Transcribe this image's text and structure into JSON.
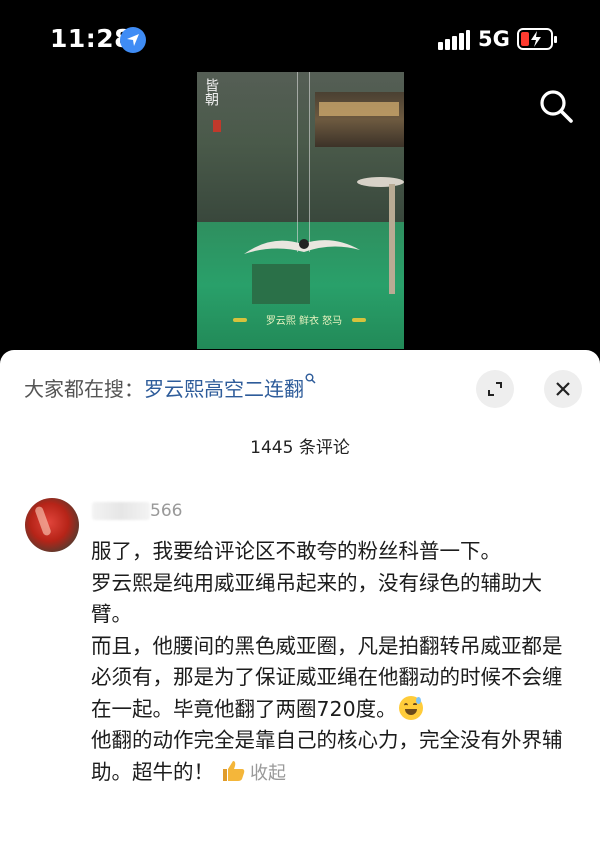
{
  "status_bar": {
    "time": "11:28",
    "network": "5G"
  },
  "video": {
    "logo_text": "皆朝",
    "caption": "罗云熙 鲜衣 怒马"
  },
  "search": {
    "prompt": "大家都在搜：",
    "term": "罗云熙高空二连翻",
    "term_icon": "search-small-icon"
  },
  "comments": {
    "count_label": "1445 条评论",
    "items": [
      {
        "username": "566",
        "paragraphs": [
          "服了，我要给评论区不敢夸的粉丝科普一下。",
          "罗云熙是纯用威亚绳吊起来的，没有绿色的辅助大臂。",
          "而且，他腰间的黑色威亚圈，凡是拍翻转吊威亚都是必须有，那是为了保证威亚绳在他翻动的时候不会缠在一起。毕竟他翻了两圈720度。",
          "他翻的动作完全是靠自己的核心力，完全没有外界辅助。超牛的！"
        ],
        "collapse_label": "收起"
      }
    ]
  },
  "colors": {
    "accent": "#2e5c9a",
    "location_badge": "#3f8cf5",
    "battery_low": "#ff3b30",
    "emoji_face": "#ffcc3a",
    "thumb": "#f4b63a"
  },
  "icons": [
    "location-arrow-icon",
    "signal-icon",
    "battery-charging-icon",
    "search-icon",
    "expand-icon",
    "close-icon",
    "grinning-sweat-emoji",
    "thumbs-up-icon"
  ]
}
